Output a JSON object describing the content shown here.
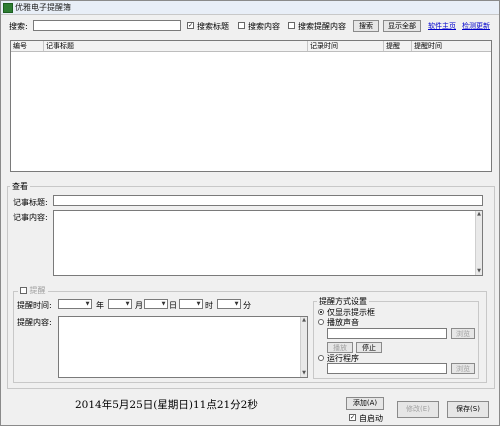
{
  "window": {
    "title": "优雅电子提醒簿"
  },
  "search": {
    "label": "搜索:",
    "value": "",
    "options": [
      {
        "label": "搜索标题",
        "checked": true
      },
      {
        "label": "搜索内容",
        "checked": false
      },
      {
        "label": "搜索提醒内容",
        "checked": false
      }
    ],
    "search_btn": "搜索",
    "show_all_btn": "显示全部",
    "link1": "软件主页",
    "link2": "检测更新"
  },
  "list": {
    "columns": [
      "编号",
      "记事标题",
      "记录时间",
      "提醒",
      "提醒时间"
    ],
    "rows": []
  },
  "view": {
    "group_label": "查看",
    "title_label": "记事标题:",
    "title_value": "",
    "content_label": "记事内容:",
    "content_value": ""
  },
  "reminder": {
    "group_label": "提醒",
    "time_label": "提醒时间:",
    "year_unit": "年",
    "month_unit": "月",
    "day_unit": "日",
    "hour_unit": "时",
    "minute_unit": "分",
    "content_label": "提醒内容:",
    "method": {
      "group_label": "提醒方式设置",
      "opt1": "仅显示提示框",
      "opt2": "播放声音",
      "opt3": "运行程序",
      "browse_btn": "浏览",
      "play_btn": "播放",
      "stop_btn": "停止"
    }
  },
  "footer": {
    "datetime": "2014年5月25日(星期日)11点21分2秒",
    "add_btn": "添加(A)",
    "autostart": "自启动",
    "modify_btn": "修改(E)",
    "save_btn": "保存(S)"
  }
}
